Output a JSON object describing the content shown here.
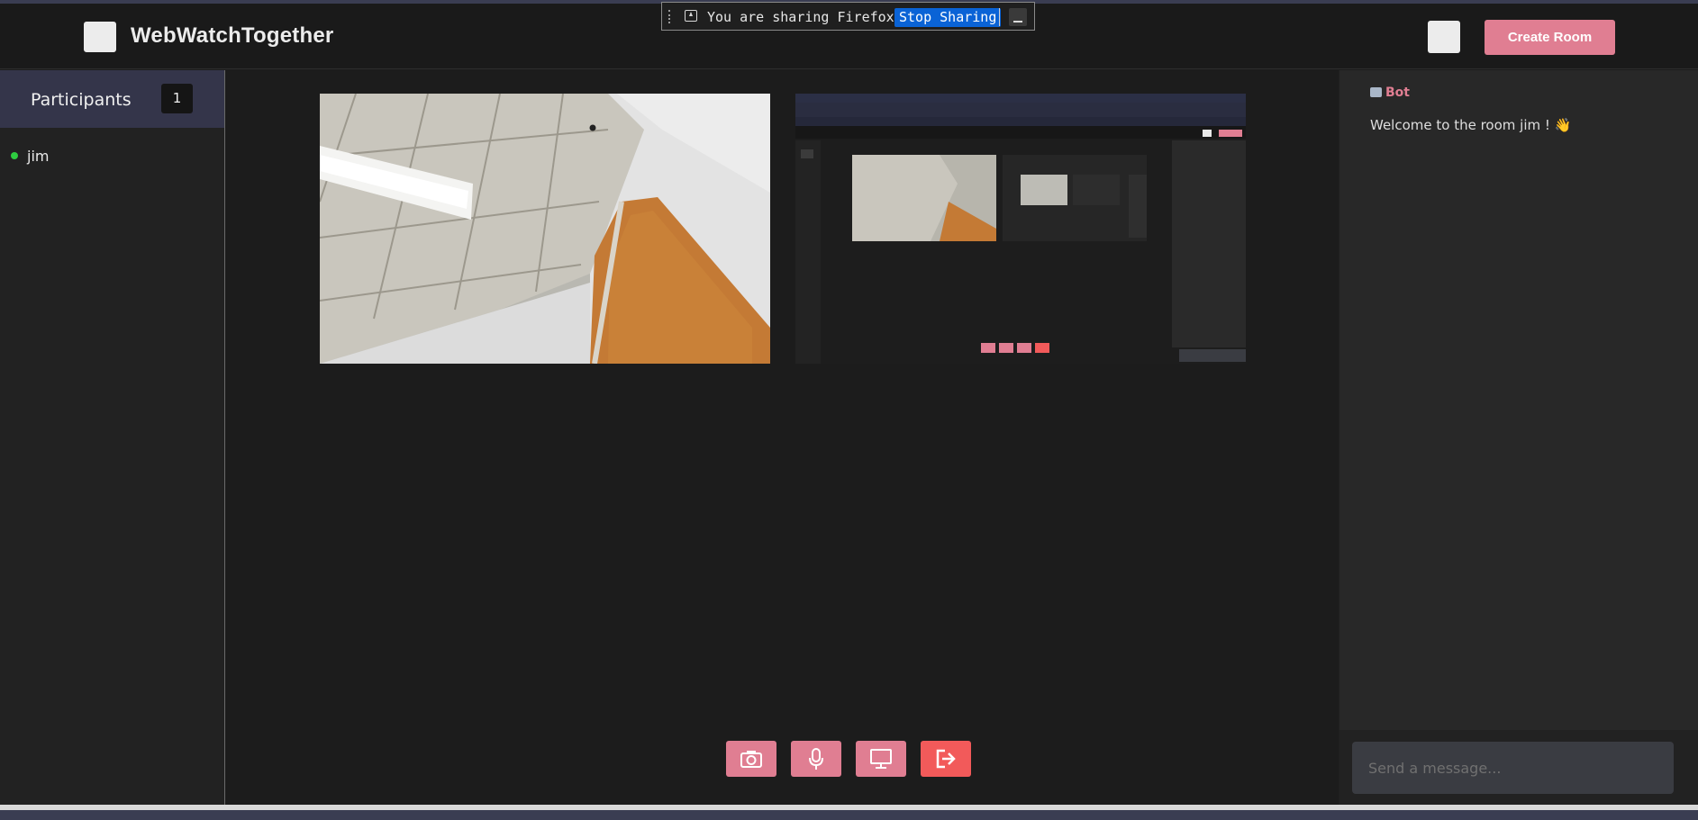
{
  "app": {
    "title": "WebWatchTogether"
  },
  "share_bar": {
    "text": "You are sharing Firefox.",
    "stop_label": "Stop Sharing"
  },
  "header": {
    "create_room_label": "Create Room"
  },
  "participants": {
    "heading": "Participants",
    "count": "1",
    "list": [
      {
        "name": "jim",
        "status_color": "#2ecc40"
      }
    ]
  },
  "videos": [
    {
      "name": "camera-feed",
      "description_icon": "webcam"
    },
    {
      "name": "screen-share-feed",
      "description_icon": "screen"
    }
  ],
  "controls": [
    {
      "name": "camera-button",
      "icon": "camera-icon",
      "color": "#e07e92"
    },
    {
      "name": "microphone-button",
      "icon": "microphone-icon",
      "color": "#e07e92"
    },
    {
      "name": "screen-share-button",
      "icon": "monitor-icon",
      "color": "#e07e92"
    },
    {
      "name": "leave-button",
      "icon": "exit-icon",
      "color": "#f25a5a"
    }
  ],
  "chat": {
    "messages": [
      {
        "sender": "Bot",
        "text": "Welcome to the room jim ! 👋"
      }
    ],
    "input_placeholder": "Send a message..."
  },
  "colors": {
    "accent": "#e07e92",
    "danger": "#f25a5a",
    "sidebar_header": "#34354a",
    "online": "#2ecc40"
  }
}
